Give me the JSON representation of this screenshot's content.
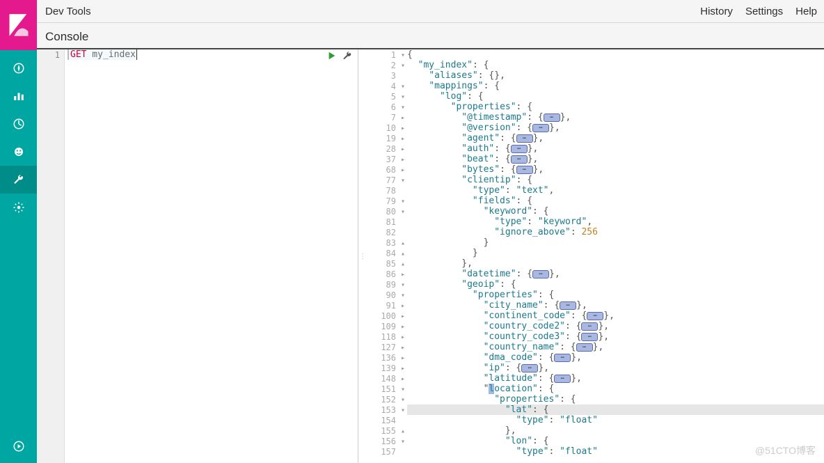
{
  "app": {
    "title": "Dev Tools",
    "subtitle": "Console"
  },
  "topLinks": {
    "history": "History",
    "settings": "Settings",
    "help": "Help"
  },
  "nav": [
    "discover-icon",
    "visualize-icon",
    "dashboard-icon",
    "timelion-icon",
    "devtools-icon",
    "management-icon"
  ],
  "navBottom": "collapse-icon",
  "request": {
    "line": "1",
    "method": "GET",
    "path": " my_index"
  },
  "splitterGlyph": "⋮",
  "watermark": "@51CTO博客",
  "response": {
    "highlight_index": 35,
    "rows": [
      {
        "num": "1",
        "fold": "▾",
        "ind": 0,
        "tokens": [
          [
            "p",
            "{"
          ]
        ]
      },
      {
        "num": "2",
        "fold": "▾",
        "ind": 1,
        "tokens": [
          [
            "k",
            "\"my_index\""
          ],
          [
            "p",
            ": {"
          ]
        ]
      },
      {
        "num": "3",
        "fold": "",
        "ind": 2,
        "tokens": [
          [
            "k",
            "\"aliases\""
          ],
          [
            "p",
            ": {},"
          ]
        ]
      },
      {
        "num": "4",
        "fold": "▾",
        "ind": 2,
        "tokens": [
          [
            "k",
            "\"mappings\""
          ],
          [
            "p",
            ": {"
          ]
        ]
      },
      {
        "num": "5",
        "fold": "▾",
        "ind": 3,
        "tokens": [
          [
            "k",
            "\"log\""
          ],
          [
            "p",
            ": {"
          ]
        ]
      },
      {
        "num": "6",
        "fold": "▾",
        "ind": 4,
        "tokens": [
          [
            "k",
            "\"properties\""
          ],
          [
            "p",
            ": {"
          ]
        ]
      },
      {
        "num": "7",
        "fold": "▸",
        "ind": 5,
        "tokens": [
          [
            "k",
            "\"@timestamp\""
          ],
          [
            "p",
            ": {"
          ],
          [
            "pill",
            ""
          ],
          [
            "p",
            "},"
          ]
        ]
      },
      {
        "num": "10",
        "fold": "▸",
        "ind": 5,
        "tokens": [
          [
            "k",
            "\"@version\""
          ],
          [
            "p",
            ": {"
          ],
          [
            "pill",
            ""
          ],
          [
            "p",
            "},"
          ]
        ]
      },
      {
        "num": "19",
        "fold": "▸",
        "ind": 5,
        "tokens": [
          [
            "k",
            "\"agent\""
          ],
          [
            "p",
            ": {"
          ],
          [
            "pill",
            ""
          ],
          [
            "p",
            "},"
          ]
        ]
      },
      {
        "num": "28",
        "fold": "▸",
        "ind": 5,
        "tokens": [
          [
            "k",
            "\"auth\""
          ],
          [
            "p",
            ": {"
          ],
          [
            "pill",
            ""
          ],
          [
            "p",
            "},"
          ]
        ]
      },
      {
        "num": "37",
        "fold": "▸",
        "ind": 5,
        "tokens": [
          [
            "k",
            "\"beat\""
          ],
          [
            "p",
            ": {"
          ],
          [
            "pill",
            ""
          ],
          [
            "p",
            "},"
          ]
        ]
      },
      {
        "num": "68",
        "fold": "▸",
        "ind": 5,
        "tokens": [
          [
            "k",
            "\"bytes\""
          ],
          [
            "p",
            ": {"
          ],
          [
            "pill",
            ""
          ],
          [
            "p",
            "},"
          ]
        ]
      },
      {
        "num": "77",
        "fold": "▾",
        "ind": 5,
        "tokens": [
          [
            "k",
            "\"clientip\""
          ],
          [
            "p",
            ": {"
          ]
        ]
      },
      {
        "num": "78",
        "fold": "",
        "ind": 6,
        "tokens": [
          [
            "k",
            "\"type\""
          ],
          [
            "p",
            ": "
          ],
          [
            "s",
            "\"text\""
          ],
          [
            "p",
            ","
          ]
        ]
      },
      {
        "num": "79",
        "fold": "▾",
        "ind": 6,
        "tokens": [
          [
            "k",
            "\"fields\""
          ],
          [
            "p",
            ": {"
          ]
        ]
      },
      {
        "num": "80",
        "fold": "▾",
        "ind": 7,
        "tokens": [
          [
            "k",
            "\"keyword\""
          ],
          [
            "p",
            ": {"
          ]
        ]
      },
      {
        "num": "81",
        "fold": "",
        "ind": 8,
        "tokens": [
          [
            "k",
            "\"type\""
          ],
          [
            "p",
            ": "
          ],
          [
            "s",
            "\"keyword\""
          ],
          [
            "p",
            ","
          ]
        ]
      },
      {
        "num": "82",
        "fold": "",
        "ind": 8,
        "tokens": [
          [
            "k",
            "\"ignore_above\""
          ],
          [
            "p",
            ": "
          ],
          [
            "n",
            "256"
          ]
        ]
      },
      {
        "num": "83",
        "fold": "▴",
        "ind": 7,
        "tokens": [
          [
            "p",
            "}"
          ]
        ]
      },
      {
        "num": "84",
        "fold": "▴",
        "ind": 6,
        "tokens": [
          [
            "p",
            "}"
          ]
        ]
      },
      {
        "num": "85",
        "fold": "▴",
        "ind": 5,
        "tokens": [
          [
            "p",
            "},"
          ]
        ]
      },
      {
        "num": "86",
        "fold": "▸",
        "ind": 5,
        "tokens": [
          [
            "k",
            "\"datetime\""
          ],
          [
            "p",
            ": {"
          ],
          [
            "pill",
            ""
          ],
          [
            "p",
            "},"
          ]
        ]
      },
      {
        "num": "89",
        "fold": "▾",
        "ind": 5,
        "tokens": [
          [
            "k",
            "\"geoip\""
          ],
          [
            "p",
            ": {"
          ]
        ]
      },
      {
        "num": "90",
        "fold": "▾",
        "ind": 6,
        "tokens": [
          [
            "k",
            "\"properties\""
          ],
          [
            "p",
            ": {"
          ]
        ]
      },
      {
        "num": "91",
        "fold": "▸",
        "ind": 7,
        "tokens": [
          [
            "k",
            "\"city_name\""
          ],
          [
            "p",
            ": {"
          ],
          [
            "pill",
            ""
          ],
          [
            "p",
            "},"
          ]
        ]
      },
      {
        "num": "100",
        "fold": "▸",
        "ind": 7,
        "tokens": [
          [
            "k",
            "\"continent_code\""
          ],
          [
            "p",
            ": {"
          ],
          [
            "pill",
            ""
          ],
          [
            "p",
            "},"
          ]
        ]
      },
      {
        "num": "109",
        "fold": "▸",
        "ind": 7,
        "tokens": [
          [
            "k",
            "\"country_code2\""
          ],
          [
            "p",
            ": {"
          ],
          [
            "pill",
            ""
          ],
          [
            "p",
            "},"
          ]
        ]
      },
      {
        "num": "118",
        "fold": "▸",
        "ind": 7,
        "tokens": [
          [
            "k",
            "\"country_code3\""
          ],
          [
            "p",
            ": {"
          ],
          [
            "pill",
            ""
          ],
          [
            "p",
            "},"
          ]
        ]
      },
      {
        "num": "127",
        "fold": "▸",
        "ind": 7,
        "tokens": [
          [
            "k",
            "\"country_name\""
          ],
          [
            "p",
            ": {"
          ],
          [
            "pill",
            ""
          ],
          [
            "p",
            "},"
          ]
        ]
      },
      {
        "num": "136",
        "fold": "▸",
        "ind": 7,
        "tokens": [
          [
            "k",
            "\"dma_code\""
          ],
          [
            "p",
            ": {"
          ],
          [
            "pill",
            ""
          ],
          [
            "p",
            "},"
          ]
        ]
      },
      {
        "num": "139",
        "fold": "▸",
        "ind": 7,
        "tokens": [
          [
            "k",
            "\"ip\""
          ],
          [
            "p",
            ": {"
          ],
          [
            "pill",
            ""
          ],
          [
            "p",
            "},"
          ]
        ]
      },
      {
        "num": "148",
        "fold": "▸",
        "ind": 7,
        "tokens": [
          [
            "k",
            "\"latitude\""
          ],
          [
            "p",
            ": {"
          ],
          [
            "pill",
            ""
          ],
          [
            "p",
            "},"
          ]
        ]
      },
      {
        "num": "151",
        "fold": "▾",
        "ind": 7,
        "tokens": [
          [
            "p",
            "\""
          ],
          [
            "sel",
            "l"
          ],
          [
            "k",
            "ocation\""
          ],
          [
            "p",
            ": {"
          ]
        ]
      },
      {
        "num": "152",
        "fold": "▾",
        "ind": 8,
        "tokens": [
          [
            "k",
            "\"properties\""
          ],
          [
            "p",
            ": {"
          ]
        ]
      },
      {
        "num": "153",
        "fold": "▾",
        "ind": 9,
        "tokens": [
          [
            "k",
            "\"lat\""
          ],
          [
            "p",
            ": {"
          ]
        ]
      },
      {
        "num": "154",
        "fold": "",
        "ind": 10,
        "tokens": [
          [
            "k",
            "\"type\""
          ],
          [
            "p",
            ": "
          ],
          [
            "s",
            "\"float\""
          ]
        ]
      },
      {
        "num": "155",
        "fold": "▴",
        "ind": 9,
        "tokens": [
          [
            "p",
            "},"
          ]
        ]
      },
      {
        "num": "156",
        "fold": "▾",
        "ind": 9,
        "tokens": [
          [
            "k",
            "\"lon\""
          ],
          [
            "p",
            ": {"
          ]
        ]
      },
      {
        "num": "157",
        "fold": "",
        "ind": 10,
        "tokens": [
          [
            "k",
            "\"type\""
          ],
          [
            "p",
            ": "
          ],
          [
            "s",
            "\"float\""
          ]
        ]
      }
    ]
  },
  "chart_data": {
    "type": "table",
    "title": "Elasticsearch index mapping (GET my_index)",
    "index": "my_index",
    "aliases": {},
    "mappings": {
      "log": {
        "properties": {
          "@timestamp": "(collapsed)",
          "@version": "(collapsed)",
          "agent": "(collapsed)",
          "auth": "(collapsed)",
          "beat": "(collapsed)",
          "bytes": "(collapsed)",
          "clientip": {
            "type": "text",
            "fields": {
              "keyword": {
                "type": "keyword",
                "ignore_above": 256
              }
            }
          },
          "datetime": "(collapsed)",
          "geoip": {
            "properties": {
              "city_name": "(collapsed)",
              "continent_code": "(collapsed)",
              "country_code2": "(collapsed)",
              "country_code3": "(collapsed)",
              "country_name": "(collapsed)",
              "dma_code": "(collapsed)",
              "ip": "(collapsed)",
              "latitude": "(collapsed)",
              "location": {
                "properties": {
                  "lat": {
                    "type": "float"
                  },
                  "lon": {
                    "type": "float"
                  }
                }
              }
            }
          }
        }
      }
    }
  }
}
